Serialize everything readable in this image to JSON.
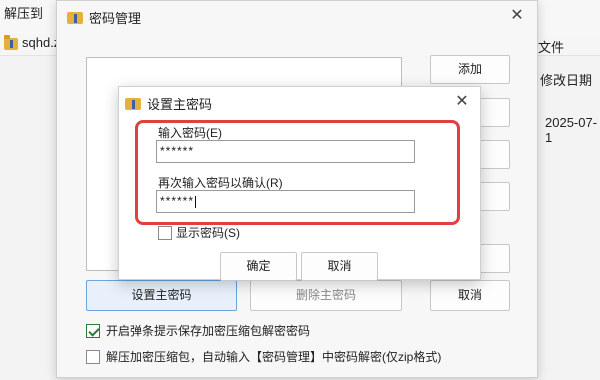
{
  "background": {
    "extract_label": "解压到",
    "file_name": "sqhd.z",
    "col_file": "文件",
    "col_date": "修改日期",
    "date_value": "2025-07-1"
  },
  "password_manager": {
    "title": "密码管理",
    "close_glyph": "✕",
    "buttons": {
      "add": "添加",
      "b": "",
      "c": "",
      "d": "",
      "e": "",
      "set_master": "设置主密码",
      "delete_master": "删除主密码",
      "cancel": "取消"
    },
    "check1": {
      "label": "开启弹条提示保存加密压缩包解密密码",
      "checked": true
    },
    "check2": {
      "label": "解压加密压缩包，自动输入【密码管理】中密码解密(仅zip格式)",
      "checked": false
    }
  },
  "master_password_dialog": {
    "title": "设置主密码",
    "close_glyph": "✕",
    "input_label": "输入密码(E)",
    "input_value": "******",
    "confirm_label": "再次输入密码以确认(R)",
    "confirm_value": "******",
    "show_password_label": "显示密码(S)",
    "show_password_checked": false,
    "ok_label": "确定",
    "cancel_label": "取消"
  },
  "colors": {
    "highlight": "#e04040",
    "accent": "#6aa5e0",
    "check": "#2a7a38"
  },
  "icons": {
    "app": "archive-app-icon",
    "folder": "folder-icon",
    "close": "close-icon"
  }
}
